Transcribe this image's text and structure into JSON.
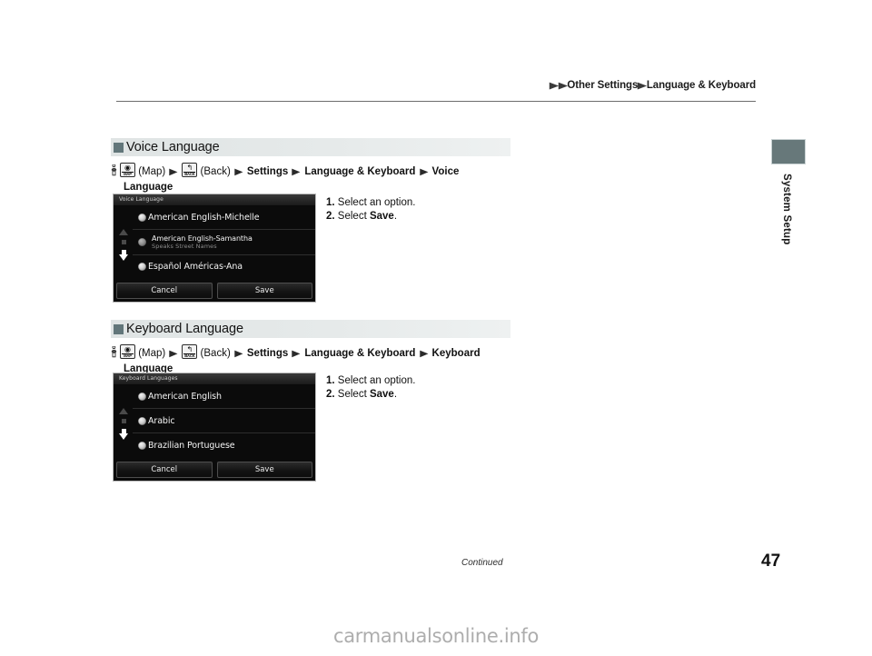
{
  "header": {
    "breadcrumb": [
      "Other Settings",
      "Language & Keyboard"
    ],
    "arrow_glyph": "▶"
  },
  "side_tab": {
    "label": "System Setup",
    "color": "#67787a"
  },
  "sections": [
    {
      "title": "Voice Language",
      "path": {
        "hand_icon": "finger-press-icon",
        "map_button": {
          "caption": "MAP",
          "glyph": "◉"
        },
        "map_label": "(Map)",
        "back_button": {
          "caption": "BACK",
          "glyph": "↰"
        },
        "back_label": "(Back)",
        "steps": [
          "Settings",
          "Language & Keyboard",
          "Voice"
        ],
        "wrap": "Language"
      },
      "screen": {
        "title": "Voice Language",
        "rows": [
          {
            "label": "American English-Michelle",
            "sub": "",
            "size": "large",
            "selected": false
          },
          {
            "label": "American English-Samantha",
            "sub": "Speaks Street Names",
            "size": "small",
            "selected": false
          },
          {
            "label": "Español Américas-Ana",
            "sub": "",
            "size": "large",
            "selected": false
          }
        ],
        "cancel": "Cancel",
        "save": "Save",
        "scroll_up_enabled": false,
        "scroll_down_enabled": true
      },
      "instructions": [
        {
          "num": "1.",
          "pre": "Select an option.",
          "bold": "",
          "post": ""
        },
        {
          "num": "2.",
          "pre": "Select ",
          "bold": "Save",
          "post": "."
        }
      ]
    },
    {
      "title": "Keyboard Language",
      "path": {
        "hand_icon": "finger-press-icon",
        "map_button": {
          "caption": "MAP",
          "glyph": "◉"
        },
        "map_label": "(Map)",
        "back_button": {
          "caption": "BACK",
          "glyph": "↰"
        },
        "back_label": "(Back)",
        "steps": [
          "Settings",
          "Language & Keyboard",
          "Keyboard"
        ],
        "wrap": "Language"
      },
      "screen": {
        "title": "Keyboard Languages",
        "rows": [
          {
            "label": "American English",
            "sub": "",
            "size": "large",
            "selected": false
          },
          {
            "label": "Arabic",
            "sub": "",
            "size": "large",
            "selected": false
          },
          {
            "label": "Brazilian Portuguese",
            "sub": "",
            "size": "large",
            "selected": false
          }
        ],
        "cancel": "Cancel",
        "save": "Save",
        "scroll_up_enabled": false,
        "scroll_down_enabled": true
      },
      "instructions": [
        {
          "num": "1.",
          "pre": "Select an option.",
          "bold": "",
          "post": ""
        },
        {
          "num": "2.",
          "pre": "Select ",
          "bold": "Save",
          "post": "."
        }
      ]
    }
  ],
  "footer": {
    "continued": "Continued",
    "page_number": "47",
    "watermark": "carmanualsonline.info"
  }
}
